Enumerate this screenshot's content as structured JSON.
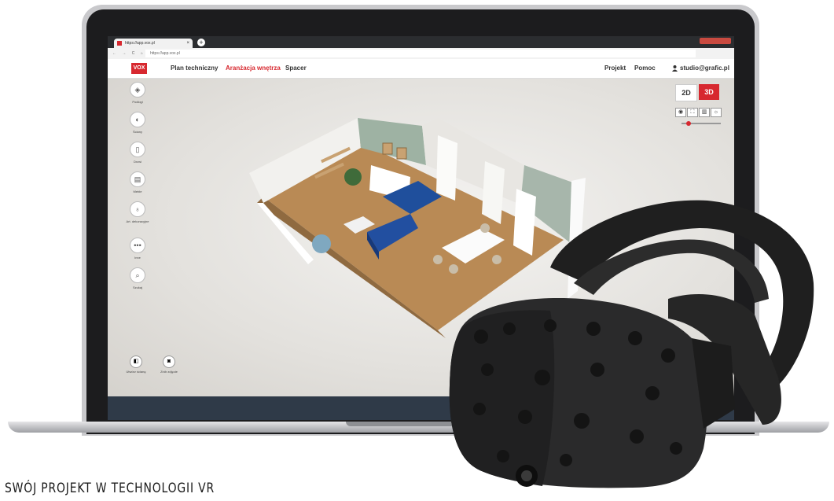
{
  "browser": {
    "tab_title": "https://app.vox.pl",
    "tab_close": "×",
    "new_tab": "+",
    "nav_glyphs": "← → C ⌂",
    "url": "https://app.vox.pl"
  },
  "app": {
    "logo": "VOX",
    "menu": [
      "Plan techniczny",
      "Aranżacja wnętrza",
      "Spacer"
    ],
    "active_menu": "Aranżacja wnętrza",
    "right_menu": [
      "Projekt",
      "Pomoc"
    ],
    "user": "studio@grafic.pl",
    "accent_color": "#d7282f"
  },
  "tools": [
    {
      "label": "Podłogi",
      "icon": "floor-icon",
      "glyph": "◈"
    },
    {
      "label": "Ściany",
      "icon": "wall-paint-icon",
      "glyph": "◐"
    },
    {
      "label": "Drzwi",
      "icon": "door-icon",
      "glyph": "▯"
    },
    {
      "label": "Meble",
      "icon": "furniture-icon",
      "glyph": "▤"
    },
    {
      "label": "Art. dekoracyjne",
      "icon": "lamp-icon",
      "glyph": "♁"
    },
    {
      "label": "Inne",
      "icon": "more-icon",
      "glyph": "•••"
    },
    {
      "label": "Szukaj",
      "icon": "search-icon",
      "glyph": "⌕"
    }
  ],
  "bottom_tools": [
    {
      "label": "Utwórz ścianę",
      "icon": "create-wall-icon",
      "glyph": "◧"
    },
    {
      "label": "Zrób zdjęcie",
      "icon": "camera-icon",
      "glyph": "◙"
    }
  ],
  "view": {
    "btn_2d": "2D",
    "btn_3d": "3D",
    "active": "3D",
    "icons": [
      "◉",
      "⛶",
      "▥",
      "☼"
    ],
    "zoom_fraction": 0.12
  },
  "caption": "SWÓJ PROJEKT W TECHNOLOGII VR"
}
